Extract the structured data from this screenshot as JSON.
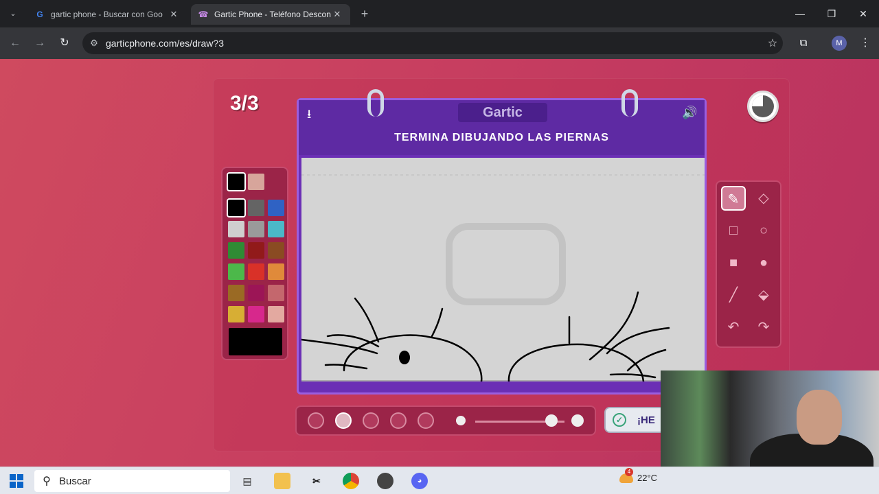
{
  "browser": {
    "tabs": [
      {
        "title": "gartic phone - Buscar con Goo",
        "icon": "google-icon"
      },
      {
        "title": "Gartic Phone - Teléfono Descon",
        "icon": "phone-icon",
        "active": true
      }
    ],
    "url": "garticphone.com/es/draw?3",
    "profile_initial": "M"
  },
  "game": {
    "round": "3/3",
    "logo": "Gartic",
    "prompt": "TERMINA DIBUJANDO LAS PIERNAS",
    "done_label": "¡HE",
    "selected_color": "#000000",
    "palette_top": [
      "#000000",
      "#d7a59b"
    ],
    "palette": [
      [
        "#000000",
        "#646464",
        "#2f62c4"
      ],
      [
        "#cfcfcf",
        "#9a9a9a",
        "#4bb8c8"
      ],
      [
        "#2f8b34",
        "#911a1a",
        "#8a4b22"
      ],
      [
        "#4cb84a",
        "#d93128",
        "#e08a3a"
      ],
      [
        "#9a6a24",
        "#9c1556",
        "#c4676d"
      ],
      [
        "#d7ae34",
        "#d7288c",
        "#e3a9a0"
      ]
    ],
    "tools": [
      [
        "pencil-icon",
        "eraser-icon"
      ],
      [
        "rectangle-outline-icon",
        "circle-outline-icon"
      ],
      [
        "rectangle-filled-icon",
        "circle-filled-icon"
      ],
      [
        "line-icon",
        "fill-bucket-icon"
      ],
      [
        "undo-icon",
        "redo-icon"
      ]
    ],
    "selected_tool": "pencil-icon",
    "brush_sizes": 5,
    "selected_brush_size": 2,
    "opacity_level": 0.85
  },
  "taskbar": {
    "search_placeholder": "Buscar",
    "weather_temp": "22°C",
    "weather_badge": "4"
  }
}
